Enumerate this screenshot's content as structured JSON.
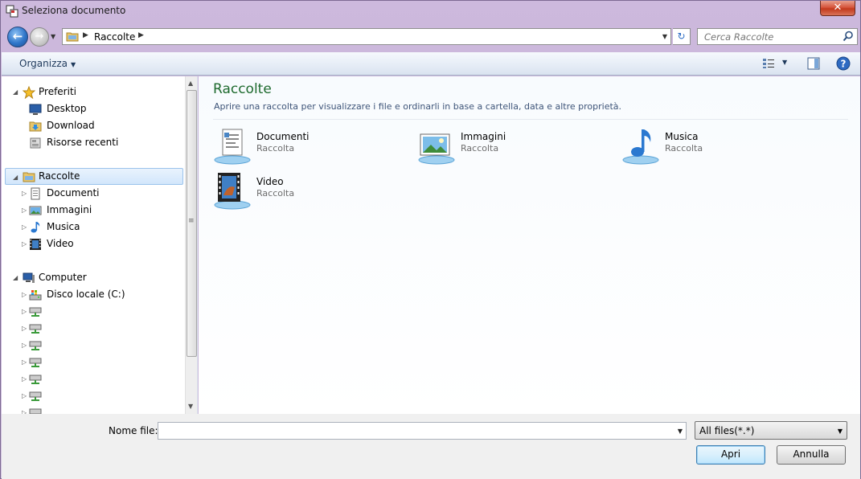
{
  "window": {
    "title": "Seleziona documento",
    "close_glyph": "✕"
  },
  "address": {
    "crumbs": [
      "Raccolte"
    ],
    "search_placeholder": "Cerca Raccolte",
    "back_glyph": "←",
    "forward_glyph": "→",
    "refresh_glyph": "↻"
  },
  "toolbar": {
    "organize_label": "Organizza"
  },
  "nav": {
    "favorites": {
      "label": "Preferiti",
      "items": [
        {
          "label": "Desktop",
          "icon": "desktop-icon"
        },
        {
          "label": "Download",
          "icon": "download-folder-icon"
        },
        {
          "label": "Risorse recenti",
          "icon": "recent-places-icon"
        }
      ]
    },
    "libraries": {
      "label": "Raccolte",
      "selected": true,
      "items": [
        {
          "label": "Documenti",
          "icon": "documents-icon"
        },
        {
          "label": "Immagini",
          "icon": "pictures-icon"
        },
        {
          "label": "Musica",
          "icon": "music-icon"
        },
        {
          "label": "Video",
          "icon": "video-icon"
        }
      ]
    },
    "computer": {
      "label": "Computer",
      "items": [
        {
          "label": "Disco locale (C:)",
          "icon": "local-disk-icon"
        },
        {
          "label": "",
          "icon": "network-drive-icon"
        },
        {
          "label": "",
          "icon": "network-drive-icon"
        },
        {
          "label": "",
          "icon": "network-drive-icon"
        },
        {
          "label": "",
          "icon": "network-drive-icon"
        },
        {
          "label": "",
          "icon": "network-drive-icon"
        },
        {
          "label": "",
          "icon": "network-drive-icon"
        },
        {
          "label": "",
          "icon": "network-drive-icon"
        }
      ]
    }
  },
  "content": {
    "title": "Raccolte",
    "description": "Aprire una raccolta per visualizzare i file e ordinarli in base a cartella, data e altre proprietà.",
    "libraries": [
      {
        "name": "Documenti",
        "type": "Raccolta",
        "icon": "documents-library-icon"
      },
      {
        "name": "Immagini",
        "type": "Raccolta",
        "icon": "pictures-library-icon"
      },
      {
        "name": "Musica",
        "type": "Raccolta",
        "icon": "music-library-icon"
      },
      {
        "name": "Video",
        "type": "Raccolta",
        "icon": "video-library-icon"
      }
    ]
  },
  "footer": {
    "filename_label": "Nome file:",
    "filename_value": "",
    "filter_value": "All files(*.*)",
    "open_label": "Apri",
    "cancel_label": "Annulla"
  },
  "colors": {
    "frame": "#c9b6d9",
    "title_green": "#1e6a2e",
    "selection": "#d2e6fb",
    "close_red": "#c23a1d"
  }
}
